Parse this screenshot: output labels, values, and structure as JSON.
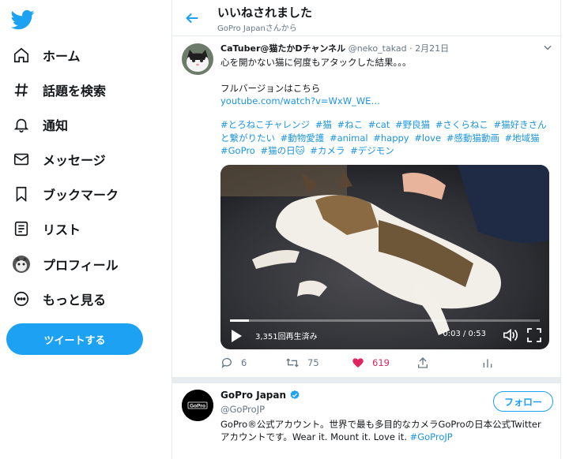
{
  "sidebar": {
    "logo_icon": "twitter-bird-icon",
    "items": [
      {
        "label": "ホーム",
        "icon": "home-icon"
      },
      {
        "label": "話題を検索",
        "icon": "hashtag-icon"
      },
      {
        "label": "通知",
        "icon": "bell-icon"
      },
      {
        "label": "メッセージ",
        "icon": "envelope-icon"
      },
      {
        "label": "ブックマーク",
        "icon": "bookmark-icon"
      },
      {
        "label": "リスト",
        "icon": "list-icon"
      },
      {
        "label": "プロフィール",
        "icon": "avatar-icon"
      },
      {
        "label": "もっと見る",
        "icon": "more-icon"
      }
    ],
    "tweet_button": "ツイートする"
  },
  "header": {
    "title": "いいねされました",
    "subtitle": "GoPro Japanさんから"
  },
  "tweet": {
    "name": "CaTuber@猫たかDチャンネル",
    "handle": "@neko_takad",
    "separator": "·",
    "date": "2月21日",
    "text": "心を開かない猫に何度もアタックした結果。。。",
    "fullversion_label": "フルバージョンはこちら",
    "link": "youtube.com/watch?v=WxW_WE…",
    "hashtags": [
      "#とろねこチャレンジ",
      "#猫",
      "#ねこ",
      "#cat",
      "#野良猫",
      "#さくらねこ",
      "#猫好きさんと繋がりたい",
      "#動物愛護",
      "#animal",
      "#happy",
      "#love",
      "#感動猫動画",
      "#地域猫",
      "#GoPro",
      "#猫の日🐱",
      "#カメラ",
      "#デジモン"
    ],
    "video": {
      "views": "3,351回再生済み",
      "time": "0:03 / 0:53",
      "progress": 0.06
    },
    "actions": {
      "replies": "6",
      "retweets": "75",
      "likes": "619"
    }
  },
  "profile": {
    "name": "GoPro Japan",
    "handle": "@GoProJP",
    "follow_label": "フォロー",
    "bio": "GoPro®公式アカウント。世界で最も多目的なカメラGoProの日本公式Twitterアカウントです。Wear it. Mount it. Love it. ",
    "bio_tag": "#GoProJP",
    "avatar_text": "GoPro"
  },
  "colors": {
    "accent": "#1da1f2",
    "like": "#e0245e",
    "muted": "#657786"
  }
}
